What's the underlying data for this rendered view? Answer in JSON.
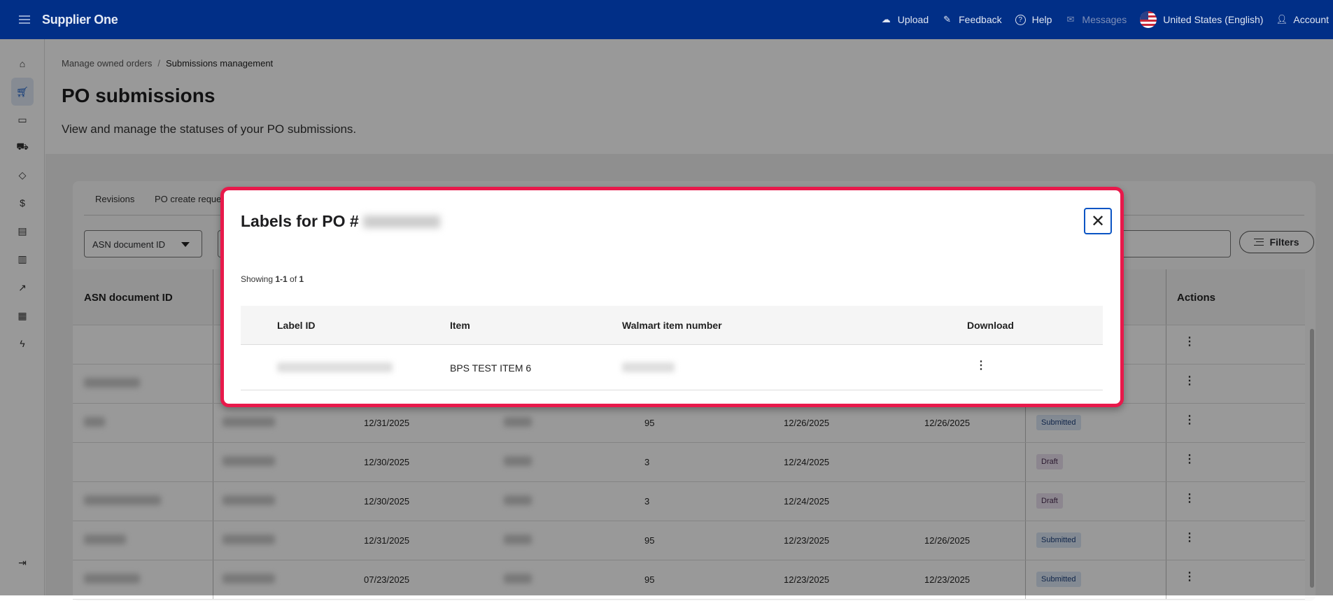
{
  "header": {
    "brand": "Supplier One",
    "nav": [
      {
        "label": "Upload",
        "icon": "cloud-upload-icon"
      },
      {
        "label": "Feedback",
        "icon": "feedback-icon"
      },
      {
        "label": "Help",
        "icon": "help-icon"
      },
      {
        "label": "Messages",
        "icon": "mail-icon"
      },
      {
        "label": "United States (English)",
        "icon": "us-flag-icon"
      },
      {
        "label": "Account",
        "icon": "user-icon"
      }
    ]
  },
  "breadcrumb": {
    "parent": "Manage owned orders",
    "separator": "/",
    "current": "Submissions management"
  },
  "page": {
    "title": "PO submissions",
    "subtitle": "View and manage the statuses of your PO submissions."
  },
  "tabs": [
    "Revisions",
    "PO create reque"
  ],
  "filter": {
    "dropdown": "ASN document ID",
    "filters_label": "Filters"
  },
  "table": {
    "headers": {
      "asn": "ASN document ID",
      "actions": "Actions"
    },
    "rows": [
      {
        "date1": "",
        "qty": "",
        "date2": "",
        "date3": "",
        "status": "",
        "status_type": ""
      },
      {
        "date1": "",
        "qty": "",
        "date2": "",
        "date3": "",
        "status": "",
        "status_type": ""
      },
      {
        "date1": "12/31/2025",
        "qty": "95",
        "date2": "12/26/2025",
        "date3": "12/26/2025",
        "status": "Submitted",
        "status_type": "sub"
      },
      {
        "date1": "12/30/2025",
        "qty": "3",
        "date2": "12/24/2025",
        "date3": "",
        "status": "Draft",
        "status_type": "draft"
      },
      {
        "date1": "12/30/2025",
        "qty": "3",
        "date2": "12/24/2025",
        "date3": "",
        "status": "Draft",
        "status_type": "draft"
      },
      {
        "date1": "12/31/2025",
        "qty": "95",
        "date2": "12/23/2025",
        "date3": "12/26/2025",
        "status": "Submitted",
        "status_type": "sub"
      },
      {
        "date1": "07/23/2025",
        "qty": "95",
        "date2": "12/23/2025",
        "date3": "12/23/2025",
        "status": "Submitted",
        "status_type": "sub"
      }
    ]
  },
  "modal": {
    "title": "Labels for PO #",
    "showing_prefix": "Showing ",
    "showing_range": "1-1",
    "showing_of": " of ",
    "showing_total": "1",
    "headers": {
      "label_id": "Label ID",
      "item": "Item",
      "walmart_item_number": "Walmart item number",
      "download": "Download"
    },
    "rows": [
      {
        "item": "BPS TEST ITEM 6"
      }
    ]
  },
  "colors": {
    "brand": "#012f87",
    "modal_highlight": "#e8194b",
    "accent": "#0a54c4"
  }
}
